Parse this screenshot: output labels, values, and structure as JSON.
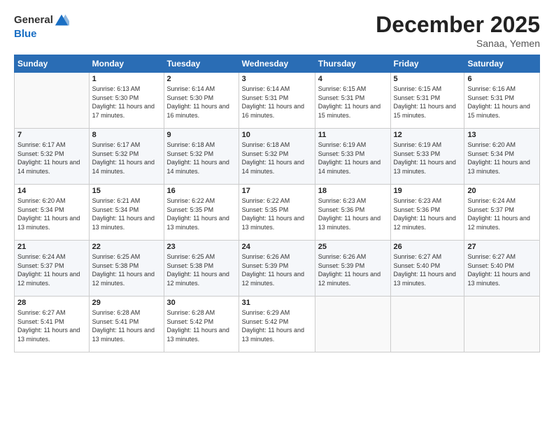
{
  "logo": {
    "general": "General",
    "blue": "Blue"
  },
  "header": {
    "month": "December 2025",
    "location": "Sanaa, Yemen"
  },
  "weekdays": [
    "Sunday",
    "Monday",
    "Tuesday",
    "Wednesday",
    "Thursday",
    "Friday",
    "Saturday"
  ],
  "weeks": [
    [
      {
        "day": "",
        "sunrise": "",
        "sunset": "",
        "daylight": ""
      },
      {
        "day": "1",
        "sunrise": "Sunrise: 6:13 AM",
        "sunset": "Sunset: 5:30 PM",
        "daylight": "Daylight: 11 hours and 17 minutes."
      },
      {
        "day": "2",
        "sunrise": "Sunrise: 6:14 AM",
        "sunset": "Sunset: 5:30 PM",
        "daylight": "Daylight: 11 hours and 16 minutes."
      },
      {
        "day": "3",
        "sunrise": "Sunrise: 6:14 AM",
        "sunset": "Sunset: 5:31 PM",
        "daylight": "Daylight: 11 hours and 16 minutes."
      },
      {
        "day": "4",
        "sunrise": "Sunrise: 6:15 AM",
        "sunset": "Sunset: 5:31 PM",
        "daylight": "Daylight: 11 hours and 15 minutes."
      },
      {
        "day": "5",
        "sunrise": "Sunrise: 6:15 AM",
        "sunset": "Sunset: 5:31 PM",
        "daylight": "Daylight: 11 hours and 15 minutes."
      },
      {
        "day": "6",
        "sunrise": "Sunrise: 6:16 AM",
        "sunset": "Sunset: 5:31 PM",
        "daylight": "Daylight: 11 hours and 15 minutes."
      }
    ],
    [
      {
        "day": "7",
        "sunrise": "Sunrise: 6:17 AM",
        "sunset": "Sunset: 5:32 PM",
        "daylight": "Daylight: 11 hours and 14 minutes."
      },
      {
        "day": "8",
        "sunrise": "Sunrise: 6:17 AM",
        "sunset": "Sunset: 5:32 PM",
        "daylight": "Daylight: 11 hours and 14 minutes."
      },
      {
        "day": "9",
        "sunrise": "Sunrise: 6:18 AM",
        "sunset": "Sunset: 5:32 PM",
        "daylight": "Daylight: 11 hours and 14 minutes."
      },
      {
        "day": "10",
        "sunrise": "Sunrise: 6:18 AM",
        "sunset": "Sunset: 5:32 PM",
        "daylight": "Daylight: 11 hours and 14 minutes."
      },
      {
        "day": "11",
        "sunrise": "Sunrise: 6:19 AM",
        "sunset": "Sunset: 5:33 PM",
        "daylight": "Daylight: 11 hours and 14 minutes."
      },
      {
        "day": "12",
        "sunrise": "Sunrise: 6:19 AM",
        "sunset": "Sunset: 5:33 PM",
        "daylight": "Daylight: 11 hours and 13 minutes."
      },
      {
        "day": "13",
        "sunrise": "Sunrise: 6:20 AM",
        "sunset": "Sunset: 5:34 PM",
        "daylight": "Daylight: 11 hours and 13 minutes."
      }
    ],
    [
      {
        "day": "14",
        "sunrise": "Sunrise: 6:20 AM",
        "sunset": "Sunset: 5:34 PM",
        "daylight": "Daylight: 11 hours and 13 minutes."
      },
      {
        "day": "15",
        "sunrise": "Sunrise: 6:21 AM",
        "sunset": "Sunset: 5:34 PM",
        "daylight": "Daylight: 11 hours and 13 minutes."
      },
      {
        "day": "16",
        "sunrise": "Sunrise: 6:22 AM",
        "sunset": "Sunset: 5:35 PM",
        "daylight": "Daylight: 11 hours and 13 minutes."
      },
      {
        "day": "17",
        "sunrise": "Sunrise: 6:22 AM",
        "sunset": "Sunset: 5:35 PM",
        "daylight": "Daylight: 11 hours and 13 minutes."
      },
      {
        "day": "18",
        "sunrise": "Sunrise: 6:23 AM",
        "sunset": "Sunset: 5:36 PM",
        "daylight": "Daylight: 11 hours and 13 minutes."
      },
      {
        "day": "19",
        "sunrise": "Sunrise: 6:23 AM",
        "sunset": "Sunset: 5:36 PM",
        "daylight": "Daylight: 11 hours and 12 minutes."
      },
      {
        "day": "20",
        "sunrise": "Sunrise: 6:24 AM",
        "sunset": "Sunset: 5:37 PM",
        "daylight": "Daylight: 11 hours and 12 minutes."
      }
    ],
    [
      {
        "day": "21",
        "sunrise": "Sunrise: 6:24 AM",
        "sunset": "Sunset: 5:37 PM",
        "daylight": "Daylight: 11 hours and 12 minutes."
      },
      {
        "day": "22",
        "sunrise": "Sunrise: 6:25 AM",
        "sunset": "Sunset: 5:38 PM",
        "daylight": "Daylight: 11 hours and 12 minutes."
      },
      {
        "day": "23",
        "sunrise": "Sunrise: 6:25 AM",
        "sunset": "Sunset: 5:38 PM",
        "daylight": "Daylight: 11 hours and 12 minutes."
      },
      {
        "day": "24",
        "sunrise": "Sunrise: 6:26 AM",
        "sunset": "Sunset: 5:39 PM",
        "daylight": "Daylight: 11 hours and 12 minutes."
      },
      {
        "day": "25",
        "sunrise": "Sunrise: 6:26 AM",
        "sunset": "Sunset: 5:39 PM",
        "daylight": "Daylight: 11 hours and 12 minutes."
      },
      {
        "day": "26",
        "sunrise": "Sunrise: 6:27 AM",
        "sunset": "Sunset: 5:40 PM",
        "daylight": "Daylight: 11 hours and 13 minutes."
      },
      {
        "day": "27",
        "sunrise": "Sunrise: 6:27 AM",
        "sunset": "Sunset: 5:40 PM",
        "daylight": "Daylight: 11 hours and 13 minutes."
      }
    ],
    [
      {
        "day": "28",
        "sunrise": "Sunrise: 6:27 AM",
        "sunset": "Sunset: 5:41 PM",
        "daylight": "Daylight: 11 hours and 13 minutes."
      },
      {
        "day": "29",
        "sunrise": "Sunrise: 6:28 AM",
        "sunset": "Sunset: 5:41 PM",
        "daylight": "Daylight: 11 hours and 13 minutes."
      },
      {
        "day": "30",
        "sunrise": "Sunrise: 6:28 AM",
        "sunset": "Sunset: 5:42 PM",
        "daylight": "Daylight: 11 hours and 13 minutes."
      },
      {
        "day": "31",
        "sunrise": "Sunrise: 6:29 AM",
        "sunset": "Sunset: 5:42 PM",
        "daylight": "Daylight: 11 hours and 13 minutes."
      },
      {
        "day": "",
        "sunrise": "",
        "sunset": "",
        "daylight": ""
      },
      {
        "day": "",
        "sunrise": "",
        "sunset": "",
        "daylight": ""
      },
      {
        "day": "",
        "sunrise": "",
        "sunset": "",
        "daylight": ""
      }
    ]
  ]
}
